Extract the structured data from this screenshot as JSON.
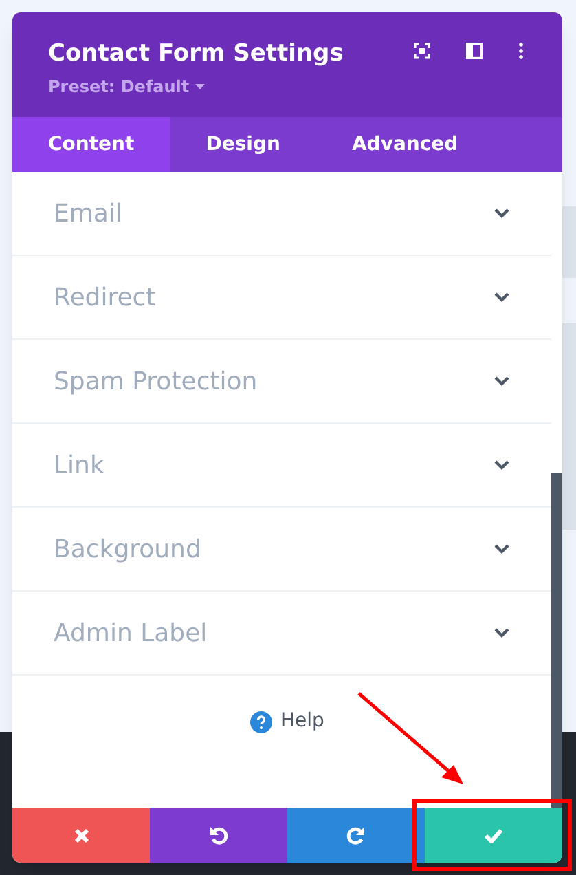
{
  "panel": {
    "title": "Contact Form Settings",
    "preset": "Preset: Default"
  },
  "tabs": [
    {
      "label": "Content",
      "selected": true
    },
    {
      "label": "Design",
      "selected": false
    },
    {
      "label": "Advanced",
      "selected": false
    }
  ],
  "sections": [
    {
      "label": "Email",
      "expanded": false
    },
    {
      "label": "Redirect",
      "expanded": false
    },
    {
      "label": "Spam Protection",
      "expanded": false
    },
    {
      "label": "Link",
      "expanded": false
    },
    {
      "label": "Background",
      "expanded": false
    },
    {
      "label": "Admin Label",
      "expanded": false
    }
  ],
  "help": "Help",
  "footer_buttons": [
    {
      "kind": "discard"
    },
    {
      "kind": "undo"
    },
    {
      "kind": "redo"
    },
    {
      "kind": "save",
      "highlighted": true
    }
  ]
}
